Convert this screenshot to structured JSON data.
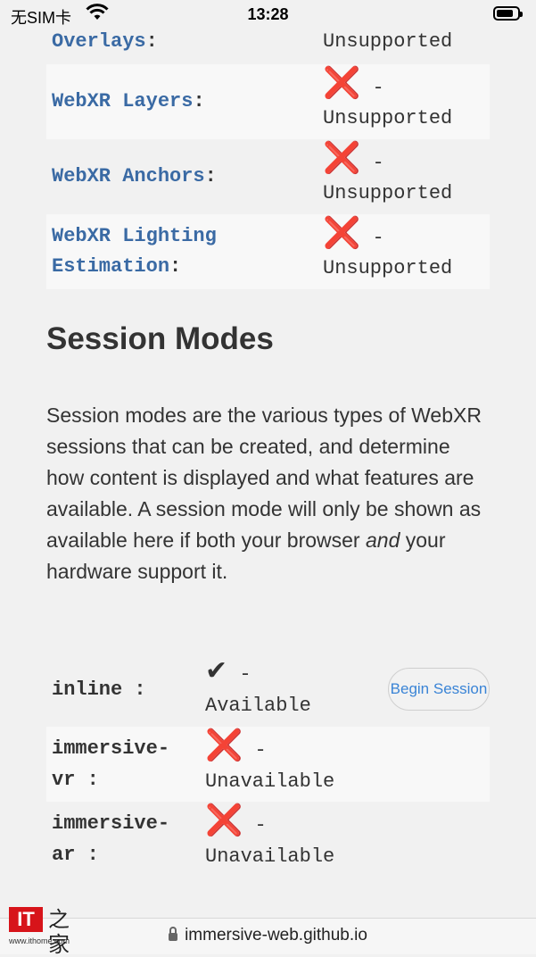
{
  "status_bar": {
    "carrier": "无SIM卡",
    "time": "13:28",
    "wifi_icon": "wifi-icon",
    "battery_icon": "battery-icon"
  },
  "features": [
    {
      "name": "Overlays",
      "colon": ":",
      "status_icon": "",
      "status_text": "Unsupported",
      "shaded": false
    },
    {
      "name": "WebXR Layers",
      "colon": ":",
      "status_icon": "❌",
      "status_text": "Unsupported",
      "shaded": true
    },
    {
      "name": "WebXR Anchors",
      "colon": ":",
      "status_icon": "❌",
      "status_text": "Unsupported",
      "shaded": false
    },
    {
      "name_line1": "WebXR Lighting",
      "name_line2": "Estimation",
      "colon": ":",
      "status_icon": "❌",
      "status_text": "Unsupported",
      "shaded": true
    }
  ],
  "dash": "-",
  "section": {
    "title": "Session Modes",
    "desc_before": "Session modes are the various types of WebXR sessions that can be created, and determine how content is displayed and what features are available. A session mode will only be shown as available here if both your browser ",
    "desc_em": "and",
    "desc_after": " your hardware support it."
  },
  "modes": [
    {
      "name": "inline :",
      "status_icon": "✔",
      "status_text": "Available",
      "button": "Begin Session"
    },
    {
      "name_line1": "immersive-",
      "name_line2": "vr :",
      "status_icon": "❌",
      "status_text": "Unavailable"
    },
    {
      "name_line1": "immersive-",
      "name_line2": "ar :",
      "status_icon": "❌",
      "status_text": "Unavailable"
    }
  ],
  "browser": {
    "url": "immersive-web.github.io",
    "lock_icon": "lock-icon"
  },
  "watermark": {
    "logo": "IT",
    "char": "之家",
    "url": "www.ithome.com"
  },
  "colors": {
    "link": "#3a6aa4",
    "error": "#e00014",
    "button_text": "#3a84d6"
  }
}
